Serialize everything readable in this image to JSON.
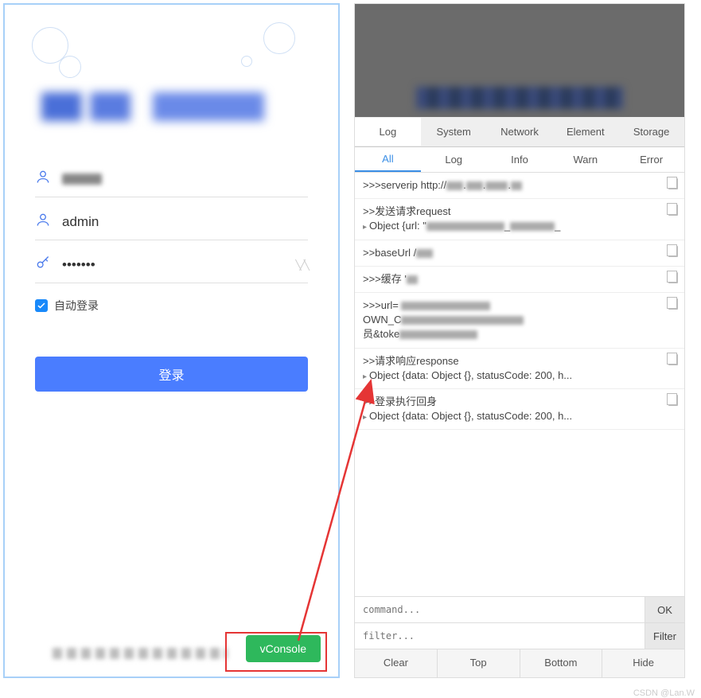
{
  "login": {
    "title_obscured": "██████ ████平台",
    "org_placeholder": "",
    "org_value_obscured": "████",
    "username_value": "admin",
    "password_masked": "•••••••",
    "auto_login_label": "自动登录",
    "auto_login_checked": true,
    "login_button_label": "登录",
    "vconsole_button_label": "vConsole",
    "footer_obscured": "██████████"
  },
  "console": {
    "header_obscured": "████████████",
    "main_tabs": [
      "Log",
      "System",
      "Network",
      "Element",
      "Storage"
    ],
    "main_active": 0,
    "sub_tabs": [
      "All",
      "Log",
      "Info",
      "Warn",
      "Error"
    ],
    "sub_active": 0,
    "logs": [
      {
        "lines": [
          ">>>serverip http://███.███.████.██"
        ]
      },
      {
        "lines": [
          ">>发送请求request",
          "{obj}Object {url: \"██████████████_████████_"
        ]
      },
      {
        "lines": [
          ">>baseUrl /███"
        ]
      },
      {
        "lines": [
          ">>>缓存 '██"
        ]
      },
      {
        "lines": [
          ">>>url= ████████████████",
          "OWN_C██████████████████████",
          "员&toke██████████████"
        ]
      },
      {
        "lines": [
          ">>请求响应response",
          "{obj}Object {data: Object {}, statusCode: 200, h..."
        ]
      },
      {
        "lines": [
          ">>登录执行回身",
          "{obj}Object {data: Object {}, statusCode: 200, h..."
        ]
      }
    ],
    "command_placeholder": "command...",
    "ok_label": "OK",
    "filter_placeholder": "filter...",
    "filter_label": "Filter",
    "bottom_buttons": [
      "Clear",
      "Top",
      "Bottom",
      "Hide"
    ]
  },
  "watermark": "CSDN @Lan.W"
}
